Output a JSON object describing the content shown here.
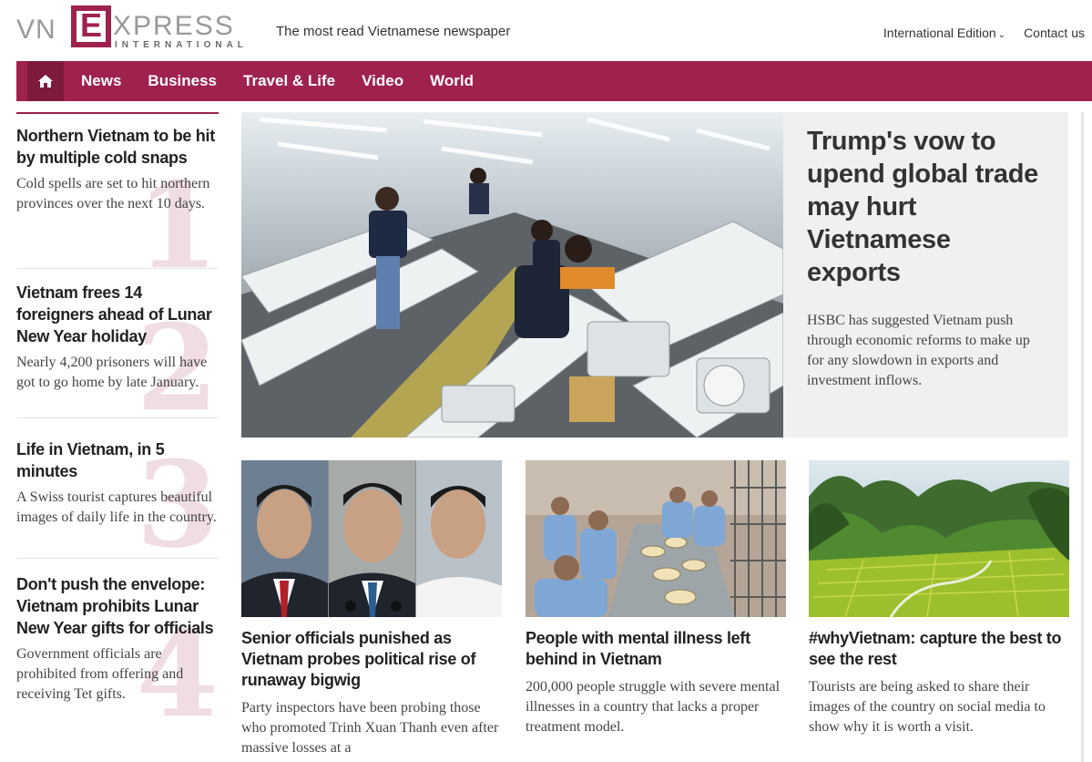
{
  "brand": {
    "vn": "VN",
    "e": "E",
    "xpress": "XPRESS",
    "international": "INTERNATIONAL",
    "tagline": "The most read Vietnamese newspaper",
    "accent_color": "#9f224e"
  },
  "top_links": {
    "edition": "International Edition",
    "contact": "Contact us"
  },
  "nav": {
    "home_icon": "home-icon",
    "items": [
      "News",
      "Business",
      "Travel & Life",
      "Video",
      "World"
    ]
  },
  "most_read": [
    {
      "rank": "1",
      "title": "Northern Vietnam to be hit by multiple cold snaps",
      "desc": "Cold spells are set to hit northern provinces over the next 10 days."
    },
    {
      "rank": "2",
      "title": "Vietnam frees 14 foreigners ahead of Lunar New Year holiday",
      "desc": "Nearly 4,200 prisoners will have got to go home by late January."
    },
    {
      "rank": "3",
      "title": "Life in Vietnam, in 5 minutes",
      "desc": "A Swiss tourist captures beautiful images of daily life in the country."
    },
    {
      "rank": "4",
      "title": "Don't push the envelope: Vietnam prohibits Lunar New Year gifts for officials",
      "desc": "Government officials are prohibited from offering and receiving Tet gifts."
    }
  ],
  "featured": {
    "title": "Trump's vow to upend global trade may hurt Vietnamese exports",
    "desc": "HSBC has suggested Vietnam push through economic reforms to make up for any slowdown in exports and investment inflows."
  },
  "articles": [
    {
      "title": "Senior officials punished as Vietnam probes political rise of runaway bigwig",
      "desc": "Party inspectors have been probing those who promoted Trinh Xuan Thanh even after massive losses at a"
    },
    {
      "title": "People with mental illness left behind in Vietnam",
      "desc": "200,000 people struggle with severe mental illnesses in a country that lacks a proper treatment model."
    },
    {
      "title": "#whyVietnam: capture the best to see the rest",
      "desc": "Tourists are being asked to share their images of the country on social media to show why it is worth a visit."
    }
  ]
}
